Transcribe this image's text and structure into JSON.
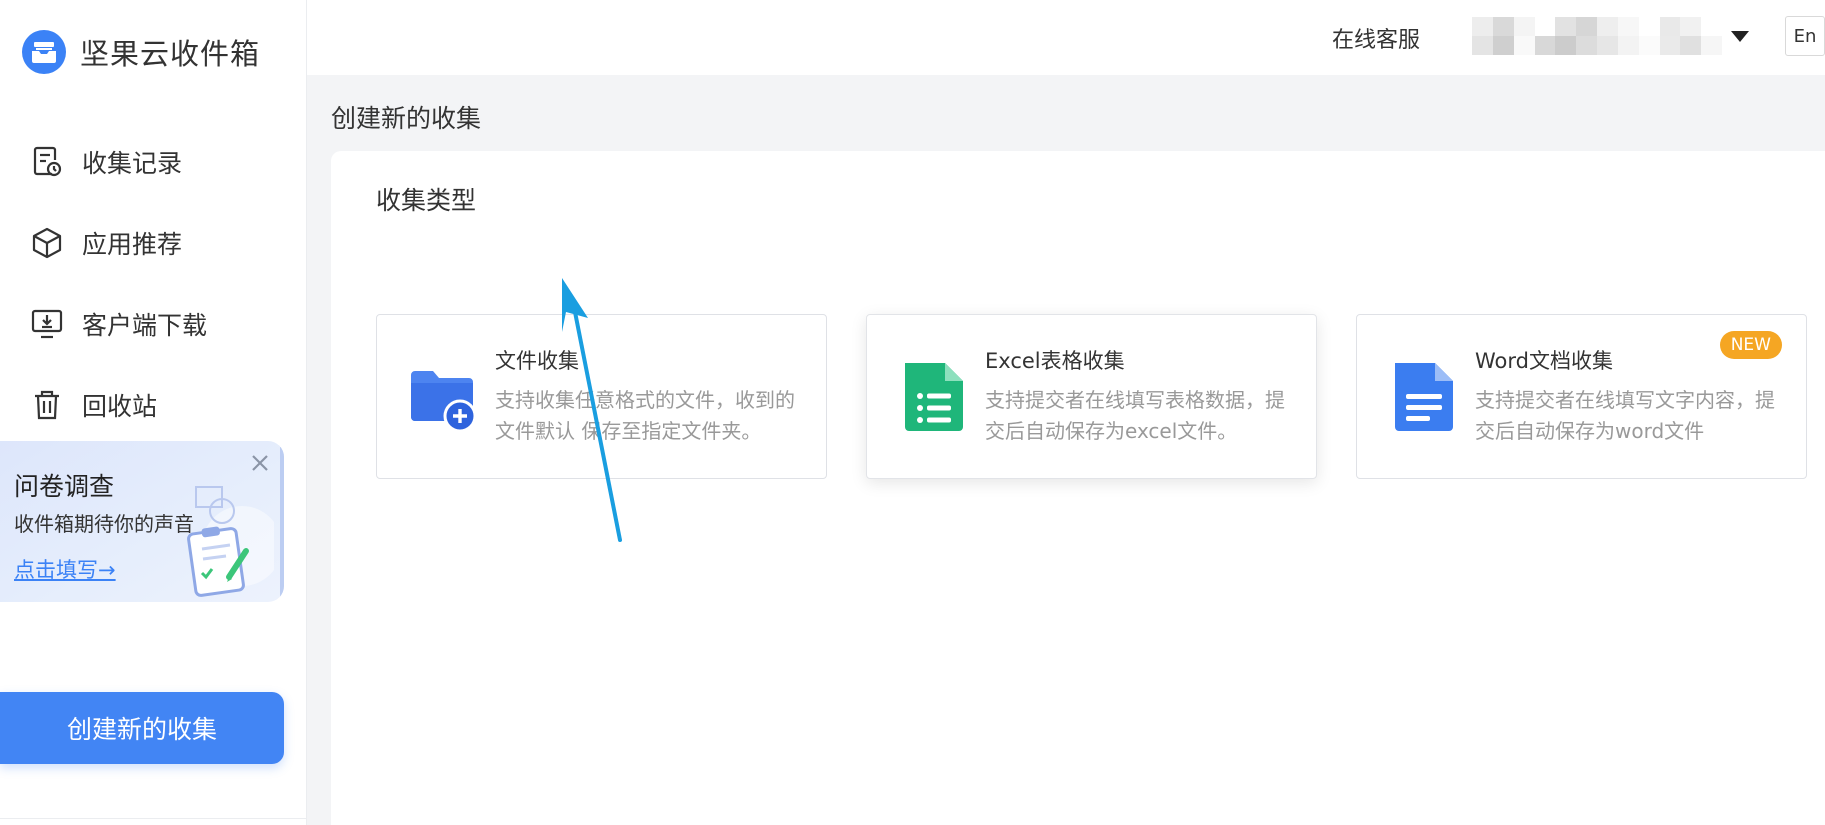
{
  "app": {
    "logo_text": "坚果云收件箱"
  },
  "sidebar": {
    "items": [
      {
        "label": "收集记录",
        "icon": "collection-record-icon"
      },
      {
        "label": "应用推荐",
        "icon": "cube-icon"
      },
      {
        "label": "客户端下载",
        "icon": "monitor-download-icon"
      },
      {
        "label": "回收站",
        "icon": "trash-icon"
      }
    ],
    "survey": {
      "title": "问卷调查",
      "subtitle": "收件箱期待你的声音",
      "link": "点击填写→"
    },
    "create_button": "创建新的收集"
  },
  "header": {
    "service": "在线客服",
    "lang": "En"
  },
  "main": {
    "page_title": "创建新的收集",
    "section_title": "收集类型",
    "cards": [
      {
        "title": "文件收集",
        "desc": "支持收集任意格式的文件，收到的文件默认 保存至指定文件夹。",
        "icon": "folder-plus-icon"
      },
      {
        "title": "Excel表格收集",
        "desc": "支持提交者在线填写表格数据，提交后自动保存为excel文件。",
        "icon": "excel-sheet-icon"
      },
      {
        "title": "Word文档收集",
        "desc": "支持提交者在线填写文字内容，提交后自动保存为word文件",
        "icon": "word-doc-icon",
        "badge": "NEW"
      }
    ]
  },
  "colors": {
    "primary": "#4285f4",
    "excel_green": "#1fb67a",
    "word_blue": "#3b7df0",
    "badge_orange": "#f5a623",
    "annotation_arrow": "#1a9ee0"
  }
}
